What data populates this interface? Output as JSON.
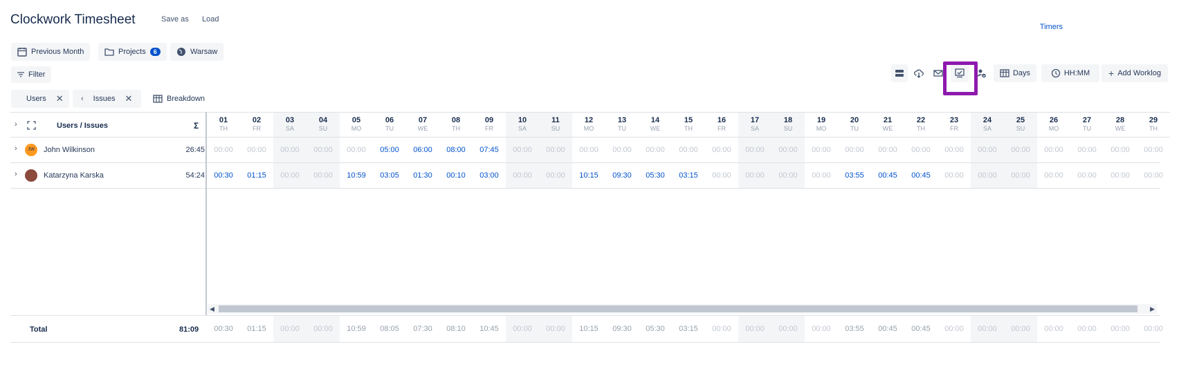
{
  "header": {
    "title": "Clockwork Timesheet",
    "save_as": "Save as",
    "load": "Load",
    "timers": "Timers"
  },
  "controls": {
    "previous_month": "Previous Month",
    "projects": "Projects",
    "projects_count": "6",
    "timezone": "Warsaw",
    "filter": "Filter"
  },
  "chips": {
    "users": "Users",
    "issues": "Issues",
    "breakdown": "Breakdown"
  },
  "toolbar": {
    "days": "Days",
    "time_format": "HH:MM",
    "add_worklog": "Add Worklog"
  },
  "grid": {
    "column_label": "Users / Issues",
    "sigma": "Σ",
    "days": [
      {
        "n": "01",
        "w": "TH",
        "weekend": false
      },
      {
        "n": "02",
        "w": "FR",
        "weekend": false
      },
      {
        "n": "03",
        "w": "SA",
        "weekend": true
      },
      {
        "n": "04",
        "w": "SU",
        "weekend": true
      },
      {
        "n": "05",
        "w": "MO",
        "weekend": false
      },
      {
        "n": "06",
        "w": "TU",
        "weekend": false
      },
      {
        "n": "07",
        "w": "WE",
        "weekend": false
      },
      {
        "n": "08",
        "w": "TH",
        "weekend": false
      },
      {
        "n": "09",
        "w": "FR",
        "weekend": false
      },
      {
        "n": "10",
        "w": "SA",
        "weekend": true
      },
      {
        "n": "11",
        "w": "SU",
        "weekend": true
      },
      {
        "n": "12",
        "w": "MO",
        "weekend": false
      },
      {
        "n": "13",
        "w": "TU",
        "weekend": false
      },
      {
        "n": "14",
        "w": "WE",
        "weekend": false
      },
      {
        "n": "15",
        "w": "TH",
        "weekend": false
      },
      {
        "n": "16",
        "w": "FR",
        "weekend": false
      },
      {
        "n": "17",
        "w": "SA",
        "weekend": true
      },
      {
        "n": "18",
        "w": "SU",
        "weekend": true
      },
      {
        "n": "19",
        "w": "MO",
        "weekend": false
      },
      {
        "n": "20",
        "w": "TU",
        "weekend": false
      },
      {
        "n": "21",
        "w": "WE",
        "weekend": false
      },
      {
        "n": "22",
        "w": "TH",
        "weekend": false
      },
      {
        "n": "23",
        "w": "FR",
        "weekend": false
      },
      {
        "n": "24",
        "w": "SA",
        "weekend": true
      },
      {
        "n": "25",
        "w": "SU",
        "weekend": true
      },
      {
        "n": "26",
        "w": "MO",
        "weekend": false
      },
      {
        "n": "27",
        "w": "TU",
        "weekend": false
      },
      {
        "n": "28",
        "w": "WE",
        "weekend": false
      },
      {
        "n": "29",
        "w": "TH",
        "weekend": false
      }
    ],
    "rows": [
      {
        "name": "John Wilkinson",
        "initials": "JW",
        "avatar_color": "#ff991f",
        "total": "26:45",
        "values": [
          "00:00",
          "00:00",
          "00:00",
          "00:00",
          "00:00",
          "05:00",
          "06:00",
          "08:00",
          "07:45",
          "00:00",
          "00:00",
          "00:00",
          "00:00",
          "00:00",
          "00:00",
          "00:00",
          "00:00",
          "00:00",
          "00:00",
          "00:00",
          "00:00",
          "00:00",
          "00:00",
          "00:00",
          "00:00",
          "00:00",
          "00:00",
          "00:00",
          "00:00"
        ]
      },
      {
        "name": "Katarzyna Karska",
        "initials": "",
        "avatar_color": "#8b4a3c",
        "total": "54:24",
        "values": [
          "00:30",
          "01:15",
          "00:00",
          "00:00",
          "10:59",
          "03:05",
          "01:30",
          "00:10",
          "03:00",
          "00:00",
          "00:00",
          "10:15",
          "09:30",
          "05:30",
          "03:15",
          "00:00",
          "00:00",
          "00:00",
          "00:00",
          "03:55",
          "00:45",
          "00:45",
          "00:00",
          "00:00",
          "00:00",
          "00:00",
          "00:00",
          "00:00",
          "00:00"
        ]
      }
    ],
    "total_label": "Total",
    "total_value": "81:09",
    "totals": [
      "00:30",
      "01:15",
      "00:00",
      "00:00",
      "10:59",
      "08:05",
      "07:30",
      "08:10",
      "10:45",
      "00:00",
      "00:00",
      "10:15",
      "09:30",
      "05:30",
      "03:15",
      "00:00",
      "00:00",
      "00:00",
      "00:00",
      "03:55",
      "00:45",
      "00:45",
      "00:00",
      "00:00",
      "00:00",
      "00:00",
      "00:00",
      "00:00",
      "00:00"
    ]
  },
  "colors": {
    "accent": "#0052cc",
    "highlight": "#8e1aad"
  }
}
